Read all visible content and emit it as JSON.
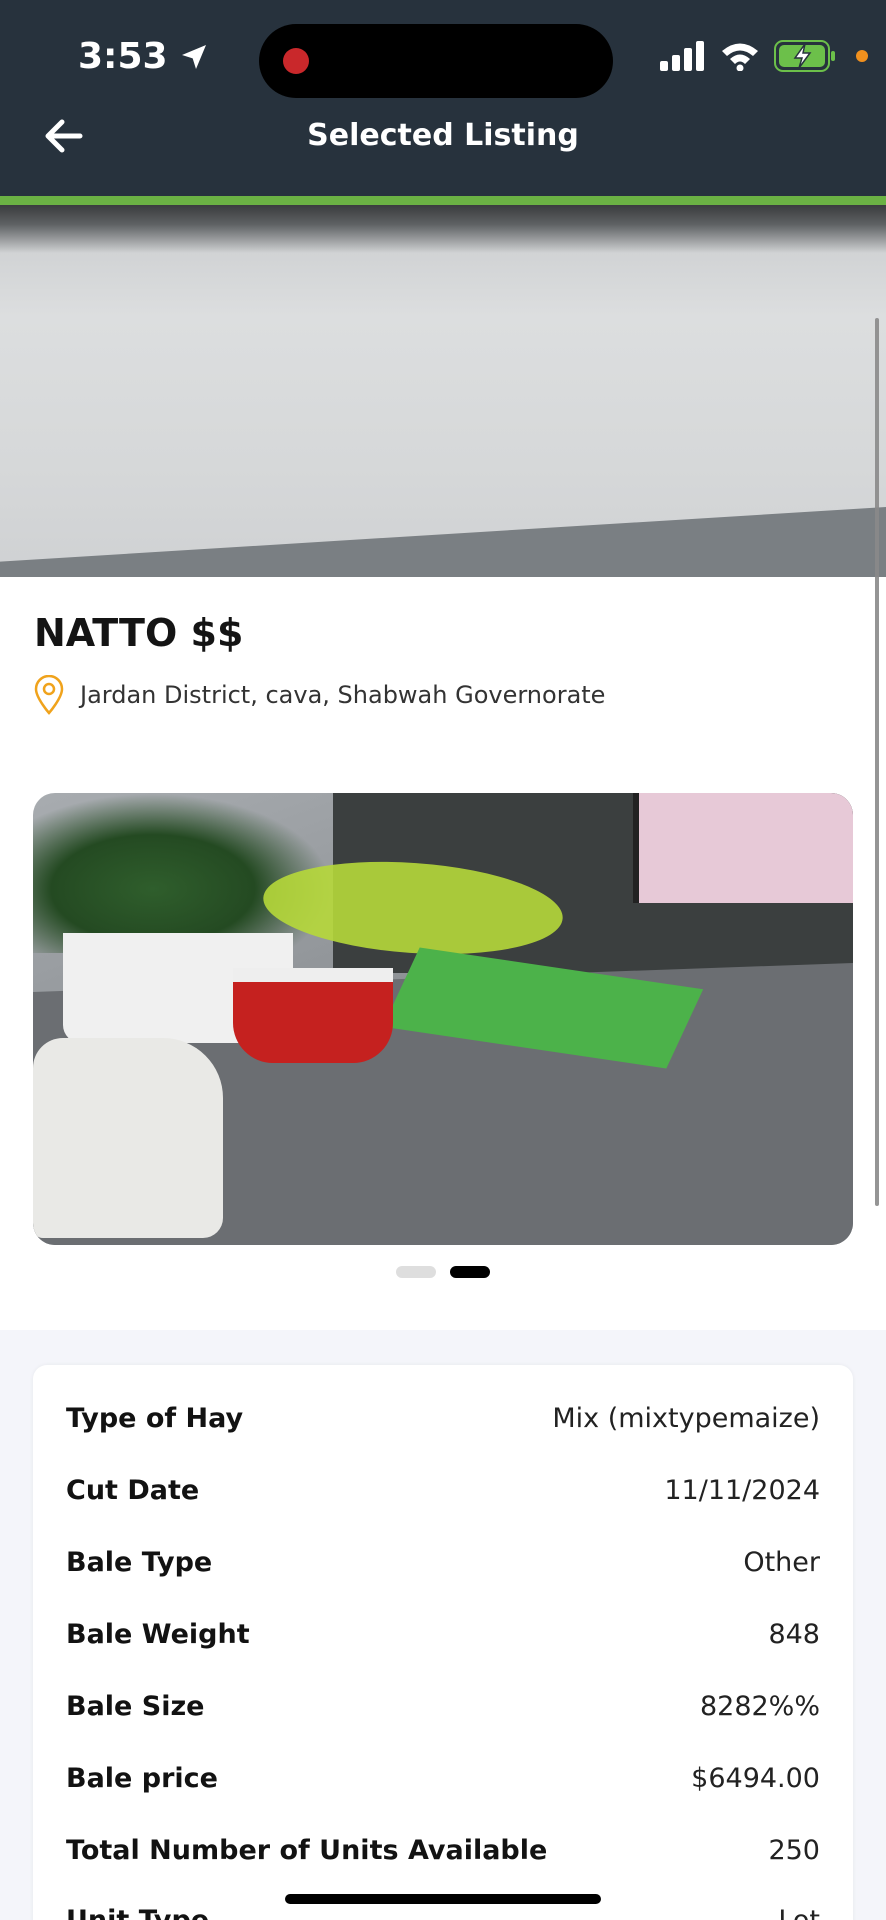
{
  "status_bar": {
    "time": "3:53",
    "location_icon": "location-arrow-icon",
    "signal_icon": "cellular-signal-icon",
    "wifi_icon": "wifi-icon",
    "battery_icon": "battery-charging-icon"
  },
  "header": {
    "title": "Selected Listing",
    "back_icon": "back-arrow-icon",
    "accent_color": "#6bb244",
    "background_color": "#27323d"
  },
  "listing": {
    "title": "NATTO $$",
    "location": "Jardan District, cava, Shabwah Governorate",
    "location_icon": "map-pin-icon",
    "carousel": {
      "total_images": 2,
      "active_index": 1
    }
  },
  "details": [
    {
      "label": "Type of Hay",
      "value": "Mix (mixtypemaize)"
    },
    {
      "label": "Cut Date",
      "value": "11/11/2024"
    },
    {
      "label": "Bale Type",
      "value": "Other"
    },
    {
      "label": "Bale Weight",
      "value": "848"
    },
    {
      "label": "Bale Size",
      "value": "8282%%"
    },
    {
      "label": "Bale price",
      "value": "$6494.00"
    },
    {
      "label": "Total Number of Units Available",
      "value": "250"
    },
    {
      "label": "Unit Type",
      "value": "Lot"
    }
  ]
}
